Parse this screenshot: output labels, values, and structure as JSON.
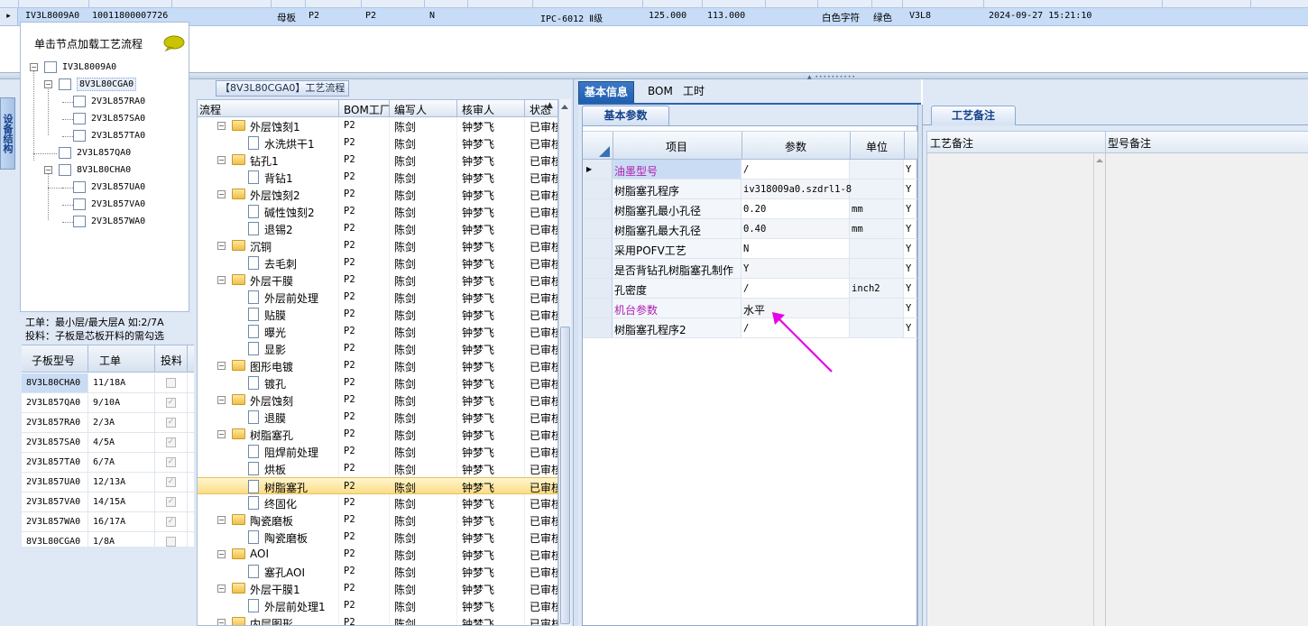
{
  "top_row": {
    "indicator": "▸",
    "code": "IV3L8009A0",
    "number": "10011800007726",
    "type": "母板",
    "plant1": "P2",
    "plant2": "P2",
    "flag": "N",
    "grade": "IPC-6012 Ⅱ级",
    "value1": "125.000",
    "value2": "113.000",
    "text_color": "白色字符",
    "ink_color": "绿色",
    "version": "V3L8",
    "datetime": "2024-09-27 15:21:10"
  },
  "structure": {
    "vertical_tab": "设备结构",
    "hint": "单击节点加载工艺流程",
    "tree": [
      {
        "label": "IV3L8009A0",
        "toggle": "−"
      },
      {
        "label": "8V3L80CGA0",
        "toggle": "−"
      },
      {
        "label": "2V3L857RA0"
      },
      {
        "label": "2V3L857SA0"
      },
      {
        "label": "2V3L857TA0"
      },
      {
        "label": "2V3L857QA0"
      },
      {
        "label": "8V3L80CHA0",
        "toggle": "−"
      },
      {
        "label": "2V3L857UA0"
      },
      {
        "label": "2V3L857VA0"
      },
      {
        "label": "2V3L857WA0"
      }
    ],
    "info_line1": "工单：最小层/最大层A 如:2/7A",
    "info_line2": "投料：子板是芯板开料的需勾选",
    "grid_headers": [
      "子板型号",
      "工单",
      "投料"
    ],
    "grid_rows": [
      {
        "model": "8V3L80CHA0",
        "order": "11/18A",
        "checked": false
      },
      {
        "model": "2V3L857QA0",
        "order": "9/10A",
        "checked": true
      },
      {
        "model": "2V3L857RA0",
        "order": "2/3A",
        "checked": true
      },
      {
        "model": "2V3L857SA0",
        "order": "4/5A",
        "checked": true
      },
      {
        "model": "2V3L857TA0",
        "order": "6/7A",
        "checked": true
      },
      {
        "model": "2V3L857UA0",
        "order": "12/13A",
        "checked": true
      },
      {
        "model": "2V3L857VA0",
        "order": "14/15A",
        "checked": true
      },
      {
        "model": "2V3L857WA0",
        "order": "16/17A",
        "checked": true
      },
      {
        "model": "8V3L80CGA0",
        "order": "1/8A",
        "checked": false
      }
    ]
  },
  "flow": {
    "caption": "【8V3L80CGA0】工艺流程",
    "headers": [
      "流程",
      "BOM工厂",
      "编写人",
      "核审人",
      "状态"
    ],
    "rows": [
      {
        "name": "外层蚀刻1",
        "kind": "group",
        "plant": "P2",
        "writer": "陈剑",
        "reviewer": "钟梦飞",
        "status": "已审核"
      },
      {
        "name": "水洗烘干1",
        "kind": "item",
        "plant": "P2",
        "writer": "陈剑",
        "reviewer": "钟梦飞",
        "status": "已审核"
      },
      {
        "name": "钻孔1",
        "kind": "group",
        "plant": "P2",
        "writer": "陈剑",
        "reviewer": "钟梦飞",
        "status": "已审核"
      },
      {
        "name": "背钻1",
        "kind": "item",
        "plant": "P2",
        "writer": "陈剑",
        "reviewer": "钟梦飞",
        "status": "已审核"
      },
      {
        "name": "外层蚀刻2",
        "kind": "group",
        "plant": "P2",
        "writer": "陈剑",
        "reviewer": "钟梦飞",
        "status": "已审核"
      },
      {
        "name": "碱性蚀刻2",
        "kind": "item",
        "plant": "P2",
        "writer": "陈剑",
        "reviewer": "钟梦飞",
        "status": "已审核"
      },
      {
        "name": "退锡2",
        "kind": "item",
        "plant": "P2",
        "writer": "陈剑",
        "reviewer": "钟梦飞",
        "status": "已审核"
      },
      {
        "name": "沉铜",
        "kind": "group",
        "plant": "P2",
        "writer": "陈剑",
        "reviewer": "钟梦飞",
        "status": "已审核"
      },
      {
        "name": "去毛刺",
        "kind": "item",
        "plant": "P2",
        "writer": "陈剑",
        "reviewer": "钟梦飞",
        "status": "已审核"
      },
      {
        "name": "外层干膜",
        "kind": "group",
        "plant": "P2",
        "writer": "陈剑",
        "reviewer": "钟梦飞",
        "status": "已审核"
      },
      {
        "name": "外层前处理",
        "kind": "item",
        "plant": "P2",
        "writer": "陈剑",
        "reviewer": "钟梦飞",
        "status": "已审核"
      },
      {
        "name": "贴膜",
        "kind": "item",
        "plant": "P2",
        "writer": "陈剑",
        "reviewer": "钟梦飞",
        "status": "已审核"
      },
      {
        "name": "曝光",
        "kind": "item",
        "plant": "P2",
        "writer": "陈剑",
        "reviewer": "钟梦飞",
        "status": "已审核"
      },
      {
        "name": "显影",
        "kind": "item",
        "plant": "P2",
        "writer": "陈剑",
        "reviewer": "钟梦飞",
        "status": "已审核"
      },
      {
        "name": "图形电镀",
        "kind": "group",
        "plant": "P2",
        "writer": "陈剑",
        "reviewer": "钟梦飞",
        "status": "已审核"
      },
      {
        "name": "镀孔",
        "kind": "item",
        "plant": "P2",
        "writer": "陈剑",
        "reviewer": "钟梦飞",
        "status": "已审核"
      },
      {
        "name": "外层蚀刻",
        "kind": "group",
        "plant": "P2",
        "writer": "陈剑",
        "reviewer": "钟梦飞",
        "status": "已审核"
      },
      {
        "name": "退膜",
        "kind": "item",
        "plant": "P2",
        "writer": "陈剑",
        "reviewer": "钟梦飞",
        "status": "已审核"
      },
      {
        "name": "树脂塞孔",
        "kind": "group",
        "plant": "P2",
        "writer": "陈剑",
        "reviewer": "钟梦飞",
        "status": "已审核"
      },
      {
        "name": "阻焊前处理",
        "kind": "item",
        "plant": "P2",
        "writer": "陈剑",
        "reviewer": "钟梦飞",
        "status": "已审核"
      },
      {
        "name": "烘板",
        "kind": "item",
        "plant": "P2",
        "writer": "陈剑",
        "reviewer": "钟梦飞",
        "status": "已审核"
      },
      {
        "name": "树脂塞孔",
        "kind": "item",
        "plant": "P2",
        "writer": "陈剑",
        "reviewer": "钟梦飞",
        "status": "已审核",
        "selected": true
      },
      {
        "name": "终固化",
        "kind": "item",
        "plant": "P2",
        "writer": "陈剑",
        "reviewer": "钟梦飞",
        "status": "已审核"
      },
      {
        "name": "陶瓷磨板",
        "kind": "group",
        "plant": "P2",
        "writer": "陈剑",
        "reviewer": "钟梦飞",
        "status": "已审核"
      },
      {
        "name": "陶瓷磨板",
        "kind": "item",
        "plant": "P2",
        "writer": "陈剑",
        "reviewer": "钟梦飞",
        "status": "已审核"
      },
      {
        "name": "AOI",
        "kind": "group",
        "plant": "P2",
        "writer": "陈剑",
        "reviewer": "钟梦飞",
        "status": "已审核"
      },
      {
        "name": "塞孔AOI",
        "kind": "item",
        "plant": "P2",
        "writer": "陈剑",
        "reviewer": "钟梦飞",
        "status": "已审核"
      },
      {
        "name": "外层干膜1",
        "kind": "group",
        "plant": "P2",
        "writer": "陈剑",
        "reviewer": "钟梦飞",
        "status": "已审核"
      },
      {
        "name": "外层前处理1",
        "kind": "item",
        "plant": "P2",
        "writer": "陈剑",
        "reviewer": "钟梦飞",
        "status": "已审核"
      },
      {
        "name": "内层图形",
        "kind": "group",
        "plant": "P2",
        "writer": "陈剑",
        "reviewer": "钟梦飞",
        "status": "已审核"
      }
    ]
  },
  "info": {
    "tabs": [
      "基本信息",
      "BOM",
      "工时"
    ],
    "subtab": "基本参数",
    "headers": [
      "项目",
      "参数",
      "单位"
    ],
    "rows": [
      {
        "name": "油墨型号",
        "value": "/",
        "unit": "",
        "flag": "Y",
        "highlight": true,
        "current": true
      },
      {
        "name": "树脂塞孔程序",
        "value": "iv318009a0.szdrl1-8",
        "unit": "",
        "flag": "Y"
      },
      {
        "name": "树脂塞孔最小孔径",
        "value": "0.20",
        "unit": "mm",
        "flag": "Y"
      },
      {
        "name": "树脂塞孔最大孔径",
        "value": "0.40",
        "unit": "mm",
        "flag": "Y"
      },
      {
        "name": "采用POFV工艺",
        "value": "N",
        "unit": "",
        "flag": "Y"
      },
      {
        "name": "是否背钻孔树脂塞孔制作",
        "value": "Y",
        "unit": "",
        "flag": "Y"
      },
      {
        "name": "孔密度",
        "value": "/",
        "unit": "inch2",
        "flag": "Y"
      },
      {
        "name": "机台参数",
        "value": "水平",
        "unit": "",
        "flag": "Y",
        "highlight": true
      },
      {
        "name": "树脂塞孔程序2",
        "value": "/",
        "unit": "",
        "flag": "Y"
      }
    ]
  },
  "remarks": {
    "tab": "工艺备注",
    "col1": "工艺备注",
    "col2": "型号备注"
  },
  "colors": {
    "accent": "#1f5fb0",
    "highlight_text": "#b01fb0",
    "selected_row": "#fbdd86",
    "annotation_arrow": "#e800e8"
  }
}
